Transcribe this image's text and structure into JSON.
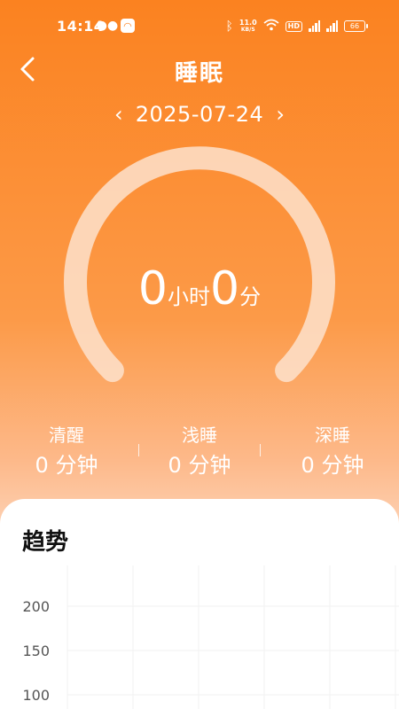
{
  "status_bar": {
    "time": "14:14",
    "net_speed_value": "11.0",
    "net_speed_unit": "KB/S",
    "hd_label": "HD",
    "battery": "66"
  },
  "header": {
    "title": "睡眠"
  },
  "date_selector": {
    "prev": "‹",
    "date": "2025-07-24",
    "next": "›"
  },
  "sleep_total": {
    "hours": "0",
    "hours_unit": "小时",
    "minutes": "0",
    "minutes_unit": "分"
  },
  "stats": [
    {
      "label": "清醒",
      "value": "0 分钟"
    },
    {
      "label": "浅睡",
      "value": "0 分钟"
    },
    {
      "label": "深睡",
      "value": "0 分钟"
    }
  ],
  "trend": {
    "title": "趋势"
  },
  "chart_data": {
    "type": "bar",
    "title": "趋势",
    "categories": [],
    "values": [],
    "y_ticks": [
      "200",
      "150",
      "100"
    ],
    "ylim": [
      100,
      200
    ],
    "grid": true
  },
  "colors": {
    "accent": "#fb8220",
    "gauge_track": "#fde3cf"
  }
}
